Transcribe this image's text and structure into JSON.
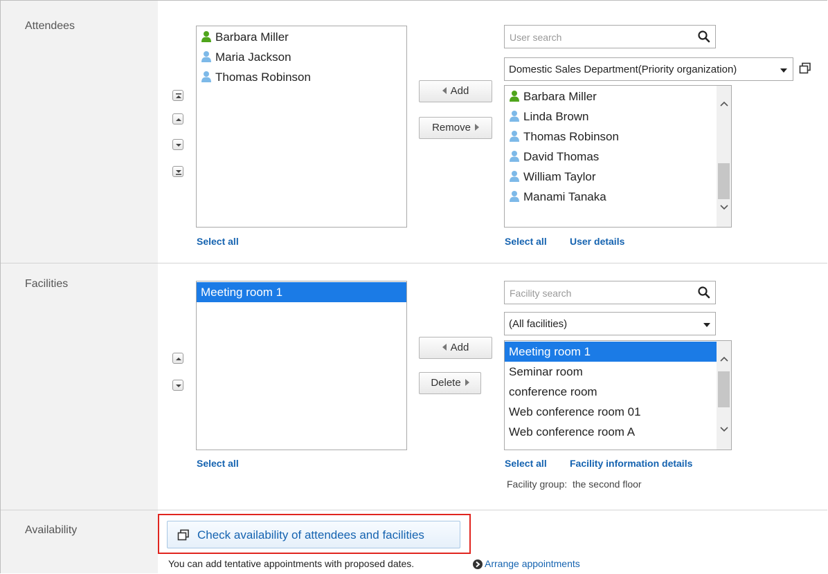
{
  "attendees": {
    "row_label": "Attendees",
    "selected": [
      {
        "name": "Barbara Miller",
        "icon": "user-green-icon"
      },
      {
        "name": "Maria Jackson",
        "icon": "user-blue-icon"
      },
      {
        "name": "Thomas Robinson",
        "icon": "user-blue-icon"
      }
    ],
    "select_all_left": "Select all",
    "add_label": "Add",
    "remove_label": "Remove",
    "search_placeholder": "User search",
    "org_select_value": "Domestic Sales Department(Priority organization)",
    "candidates": [
      {
        "name": "Barbara Miller",
        "icon": "user-green-icon"
      },
      {
        "name": "Linda Brown",
        "icon": "user-blue-icon"
      },
      {
        "name": "Thomas Robinson",
        "icon": "user-blue-icon"
      },
      {
        "name": "David Thomas",
        "icon": "user-blue-icon"
      },
      {
        "name": "William Taylor",
        "icon": "user-blue-icon"
      },
      {
        "name": "Manami Tanaka",
        "icon": "user-blue-icon"
      }
    ],
    "select_all_right": "Select all",
    "user_details": "User details"
  },
  "facilities": {
    "row_label": "Facilities",
    "selected": [
      "Meeting room 1"
    ],
    "select_all_left": "Select all",
    "add_label": "Add",
    "delete_label": "Delete",
    "search_placeholder": "Facility search",
    "group_select_value": "(All facilities)",
    "candidates": [
      "Meeting room 1",
      "Seminar room",
      "conference room",
      "Web conference room 01",
      "Web conference room A"
    ],
    "select_all_right": "Select all",
    "facility_details": "Facility information details",
    "group_label": "Facility group:",
    "group_value": "the second floor"
  },
  "availability": {
    "row_label": "Availability",
    "check_button": "Check availability of attendees and facilities",
    "note": "You can add tentative appointments with proposed dates.",
    "arrange_link": "Arrange appointments"
  },
  "colors": {
    "selection": "#1b7be6",
    "link": "#1563b0",
    "highlight_box": "#e0251f",
    "user_green": "#4fa51c",
    "user_blue": "#7db9e8"
  }
}
